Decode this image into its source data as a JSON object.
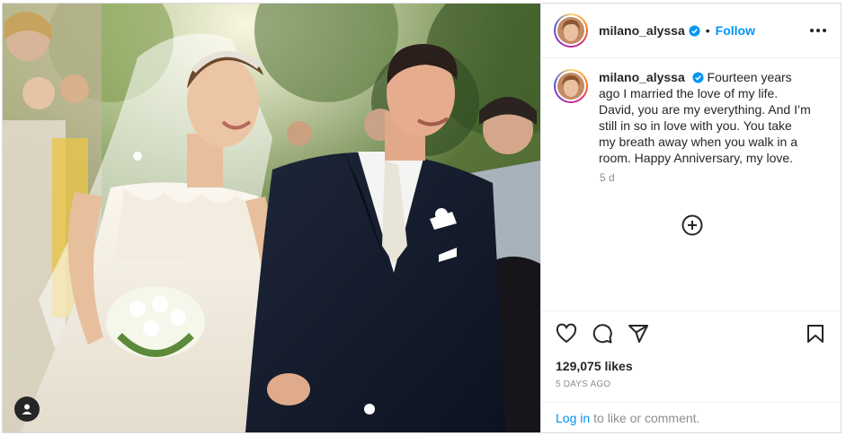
{
  "post": {
    "author": "milano_alyssa",
    "follow_label": "Follow",
    "separator": "•",
    "caption": "Fourteen years ago I married the love of my life. David, you are my everything. And I’m still in so in love with you. You take my breath away when you walk in a room. Happy Anniversary, my love.",
    "caption_age": "5 d",
    "likes": "129,075 likes",
    "posted_ago": "5 DAYS AGO",
    "login_link": "Log in",
    "login_suffix": "to like or comment."
  },
  "icons": {
    "verified": "verified-badge-icon",
    "more": "more-options-icon",
    "load_more": "plus-circle-icon",
    "like": "heart-icon",
    "comment": "comment-bubble-icon",
    "share": "paper-plane-icon",
    "save": "bookmark-icon",
    "tagged": "user-tag-icon"
  },
  "colors": {
    "accent": "#0095f6",
    "text": "#262626",
    "muted": "#8e8e8e",
    "border": "#efefef"
  }
}
